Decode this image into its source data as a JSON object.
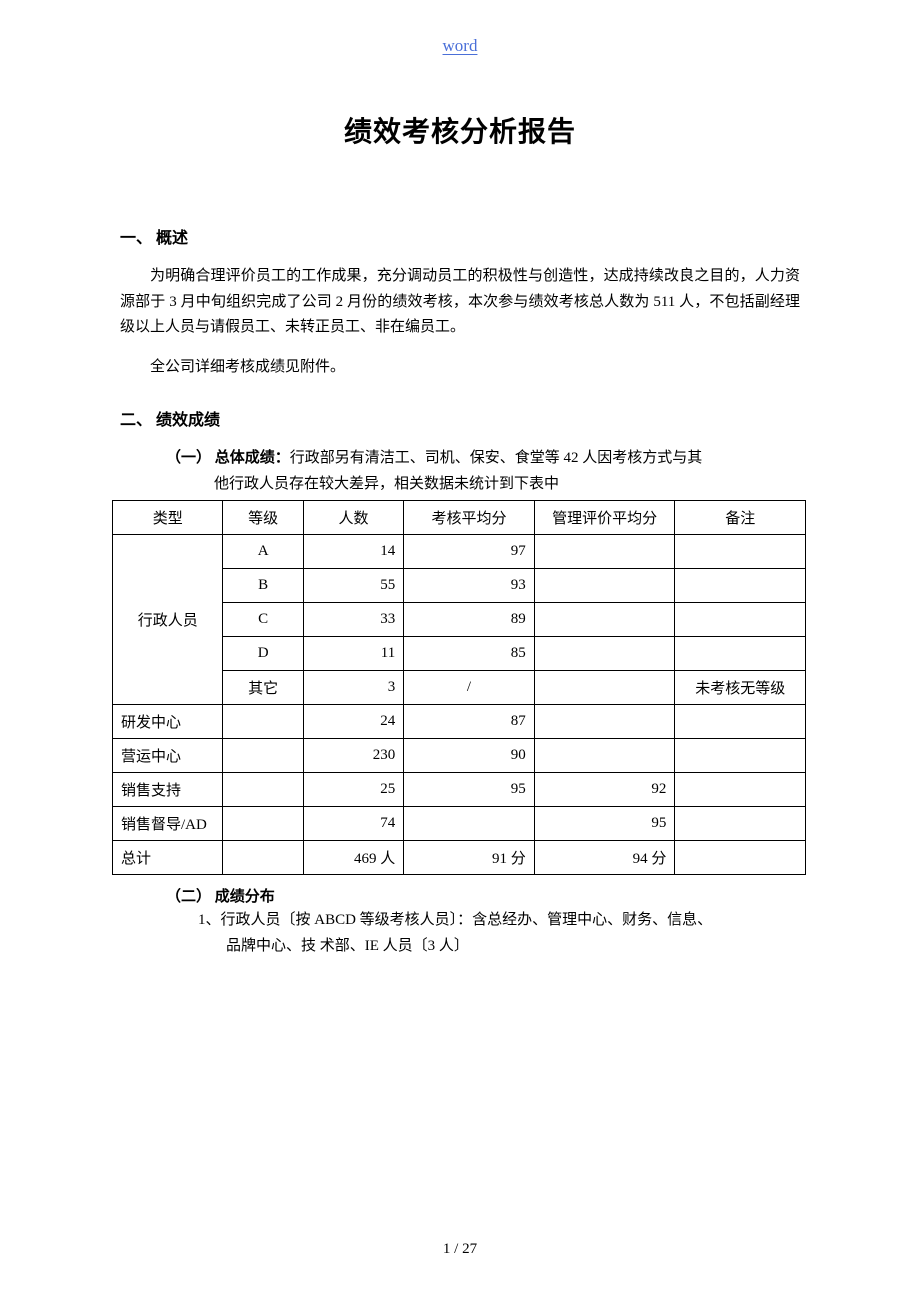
{
  "header": {
    "link_text": "word"
  },
  "title": "绩效考核分析报告",
  "section1": {
    "heading": "一、 概述",
    "p1": "为明确合理评价员工的工作成果，充分调动员工的积极性与创造性，达成持续改良之目的，人力资源部于 3 月中旬组织完成了公司 2 月份的绩效考核，本次参与绩效考核总人数为 511 人，不包括副经理级以上人员与请假员工、未转正员工、非在编员工。",
    "p2": "全公司详细考核成绩见附件。"
  },
  "section2": {
    "heading": "二、 绩效成绩",
    "sub1_label": "（一） 总体成绩：",
    "sub1_text": "行政部另有清洁工、司机、保安、食堂等 42 人因考核方式与其",
    "sub1_cont": "他行政人员存在较大差异，相关数据未统计到下表中",
    "table": {
      "headers": [
        "类型",
        "等级",
        "人数",
        "考核平均分",
        "管理评价平均分",
        "备注"
      ],
      "rows": [
        {
          "type": "行政人员",
          "grade": "A",
          "count": "14",
          "avg": "97",
          "mgmt": "",
          "note": "",
          "rowspan": 5
        },
        {
          "type": "",
          "grade": "B",
          "count": "55",
          "avg": "93",
          "mgmt": "",
          "note": ""
        },
        {
          "type": "",
          "grade": "C",
          "count": "33",
          "avg": "89",
          "mgmt": "",
          "note": ""
        },
        {
          "type": "",
          "grade": "D",
          "count": "11",
          "avg": "85",
          "mgmt": "",
          "note": ""
        },
        {
          "type": "",
          "grade": "其它",
          "count": "3",
          "avg": "/",
          "mgmt": "",
          "note": "未考核无等级"
        },
        {
          "type": "研发中心",
          "grade": "",
          "count": "24",
          "avg": "87",
          "mgmt": "",
          "note": ""
        },
        {
          "type": "营运中心",
          "grade": "",
          "count": "230",
          "avg": "90",
          "mgmt": "",
          "note": ""
        },
        {
          "type": "销售支持",
          "grade": "",
          "count": "25",
          "avg": "95",
          "mgmt": "92",
          "note": ""
        },
        {
          "type": "销售督导/AD",
          "grade": "",
          "count": "74",
          "avg": "",
          "mgmt": "95",
          "note": ""
        },
        {
          "type": "总计",
          "grade": "",
          "count": "469 人",
          "avg": "91 分",
          "mgmt": "94 分",
          "note": ""
        }
      ]
    },
    "sub2_label": "（二） 成绩分布",
    "list1_text": "1、行政人员〔按 ABCD 等级考核人员〕：含总经办、管理中心、财务、信息、",
    "list1_cont": "品牌中心、技 术部、IE 人员〔3 人〕"
  },
  "footer": {
    "page_indicator": "1 / 27"
  }
}
